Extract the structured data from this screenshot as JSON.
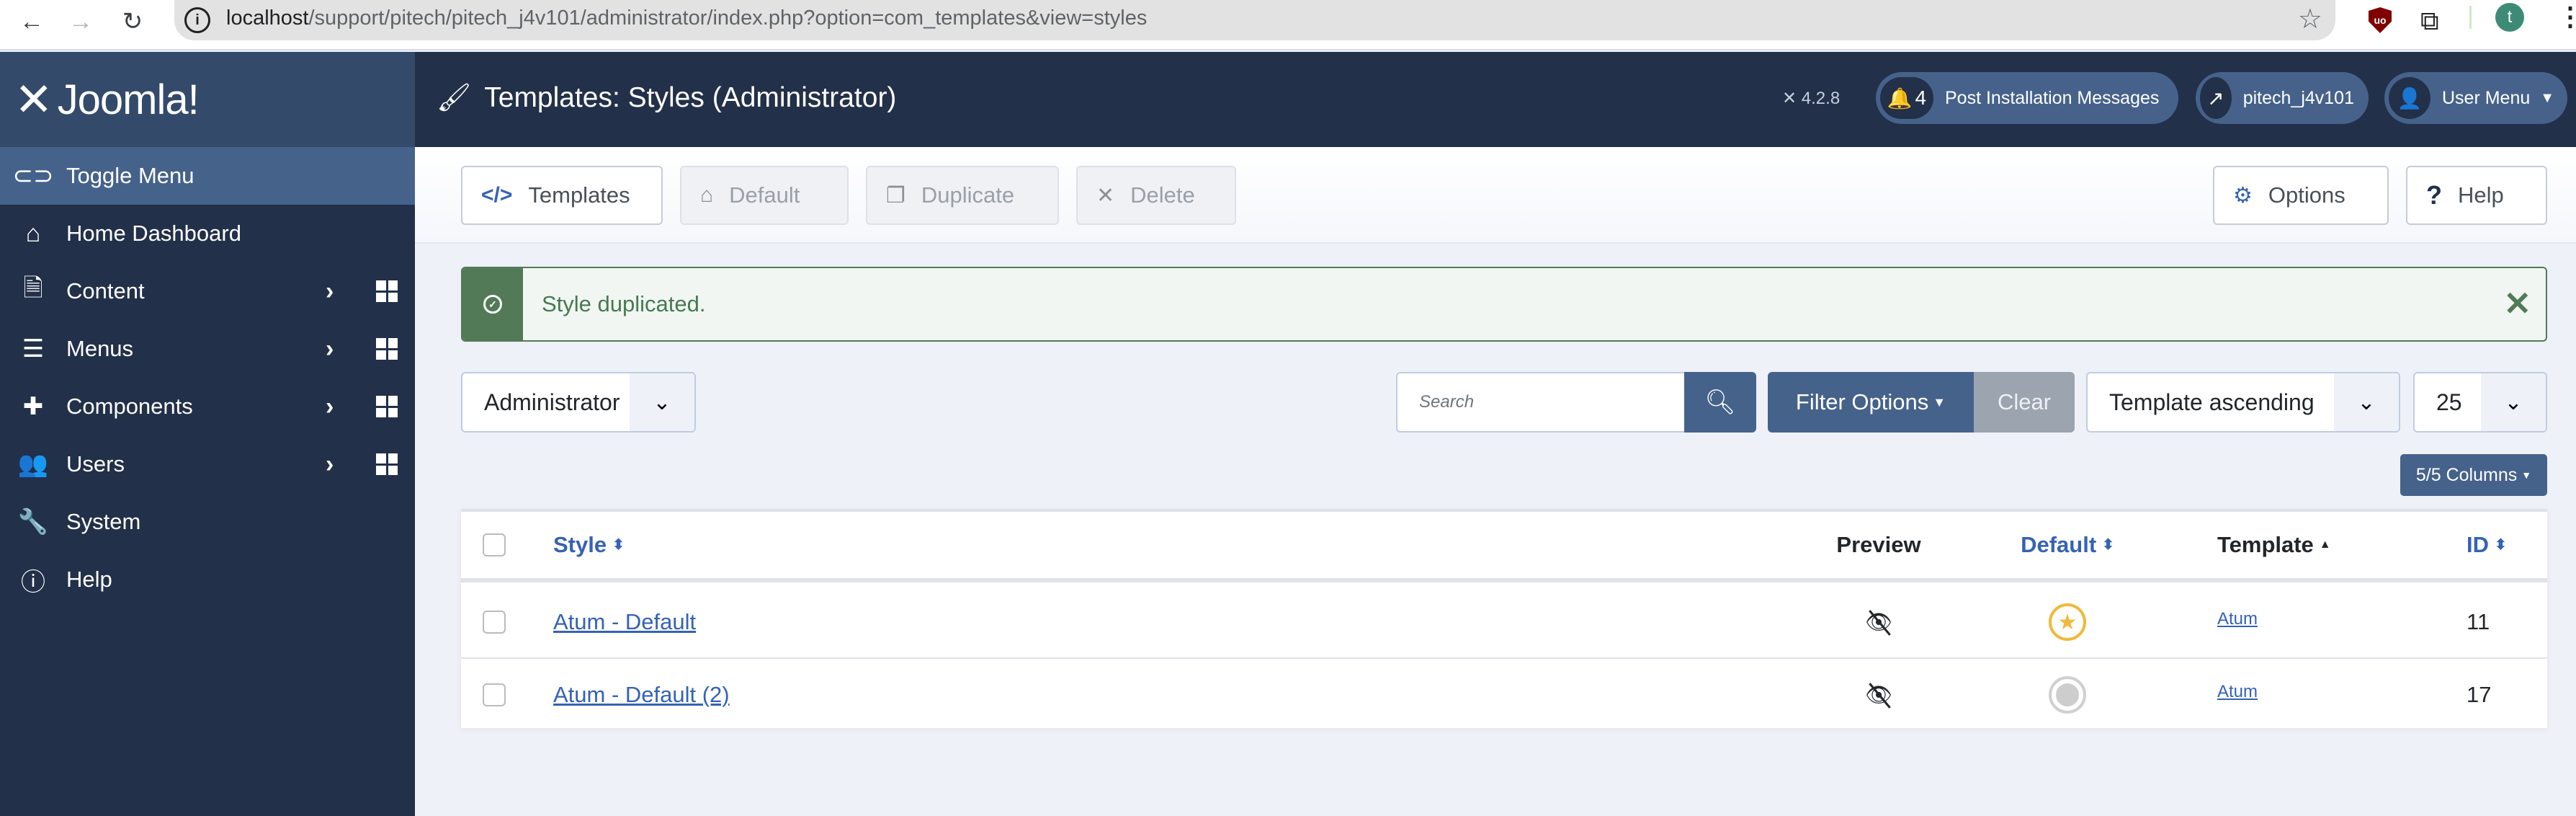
{
  "browser": {
    "back_icon": "←",
    "forward_icon": "→",
    "reload_icon": "↻",
    "url_host": "localhost",
    "url_path": "/support/pitech/pitech_j4v101/administrator/index.php?option=com_templates&view=styles",
    "bookmark_icon": "☆",
    "ublock_label": "uo",
    "extensions_icon": "⧉",
    "profile_initial": "t",
    "menu_icon": "⋮"
  },
  "header": {
    "logo_text": "Joomla!",
    "logo_mark": "✕",
    "page_title": "Templates: Styles (Administrator)",
    "title_icon": "🖌",
    "version": "4.2.8",
    "post_install": {
      "count": "4",
      "label": "Post Installation Messages"
    },
    "site_link": {
      "label": "pitech_j4v101"
    },
    "user_menu": {
      "label": "User Menu"
    }
  },
  "sidebar": {
    "items": [
      {
        "label": "Toggle Menu",
        "icon": "toggle-icon",
        "active": true
      },
      {
        "label": "Home Dashboard",
        "icon": "home-icon"
      },
      {
        "label": "Content",
        "icon": "file-icon",
        "submenu": true
      },
      {
        "label": "Menus",
        "icon": "list-icon",
        "submenu": true
      },
      {
        "label": "Components",
        "icon": "puzzle-icon",
        "submenu": true
      },
      {
        "label": "Users",
        "icon": "users-icon",
        "submenu": true
      },
      {
        "label": "System",
        "icon": "wrench-icon"
      },
      {
        "label": "Help",
        "icon": "info-icon"
      }
    ]
  },
  "toolbar": {
    "templates": "Templates",
    "default": "Default",
    "duplicate": "Duplicate",
    "delete": "Delete",
    "options": "Options",
    "help": "Help"
  },
  "alert": {
    "message": "Style duplicated.",
    "type": "success"
  },
  "filters": {
    "client": "Administrator",
    "search_placeholder": "Search",
    "search_value": "",
    "filter_options": "Filter Options",
    "clear": "Clear",
    "ordering": "Template ascending",
    "limit": "25",
    "columns": "5/5 Columns"
  },
  "table": {
    "headers": {
      "style": "Style",
      "preview": "Preview",
      "default": "Default",
      "template": "Template",
      "id": "ID"
    },
    "rows": [
      {
        "style": "Atum - Default",
        "preview": "disabled",
        "default": true,
        "template": "Atum",
        "id": "11"
      },
      {
        "style": "Atum - Default (2)",
        "preview": "disabled",
        "default": false,
        "template": "Atum",
        "id": "17"
      }
    ]
  },
  "colors": {
    "header_bg": "#223049",
    "accent": "#45628b",
    "link": "#3562b5",
    "success": "#527a57",
    "default_star": "#f0b93b"
  }
}
